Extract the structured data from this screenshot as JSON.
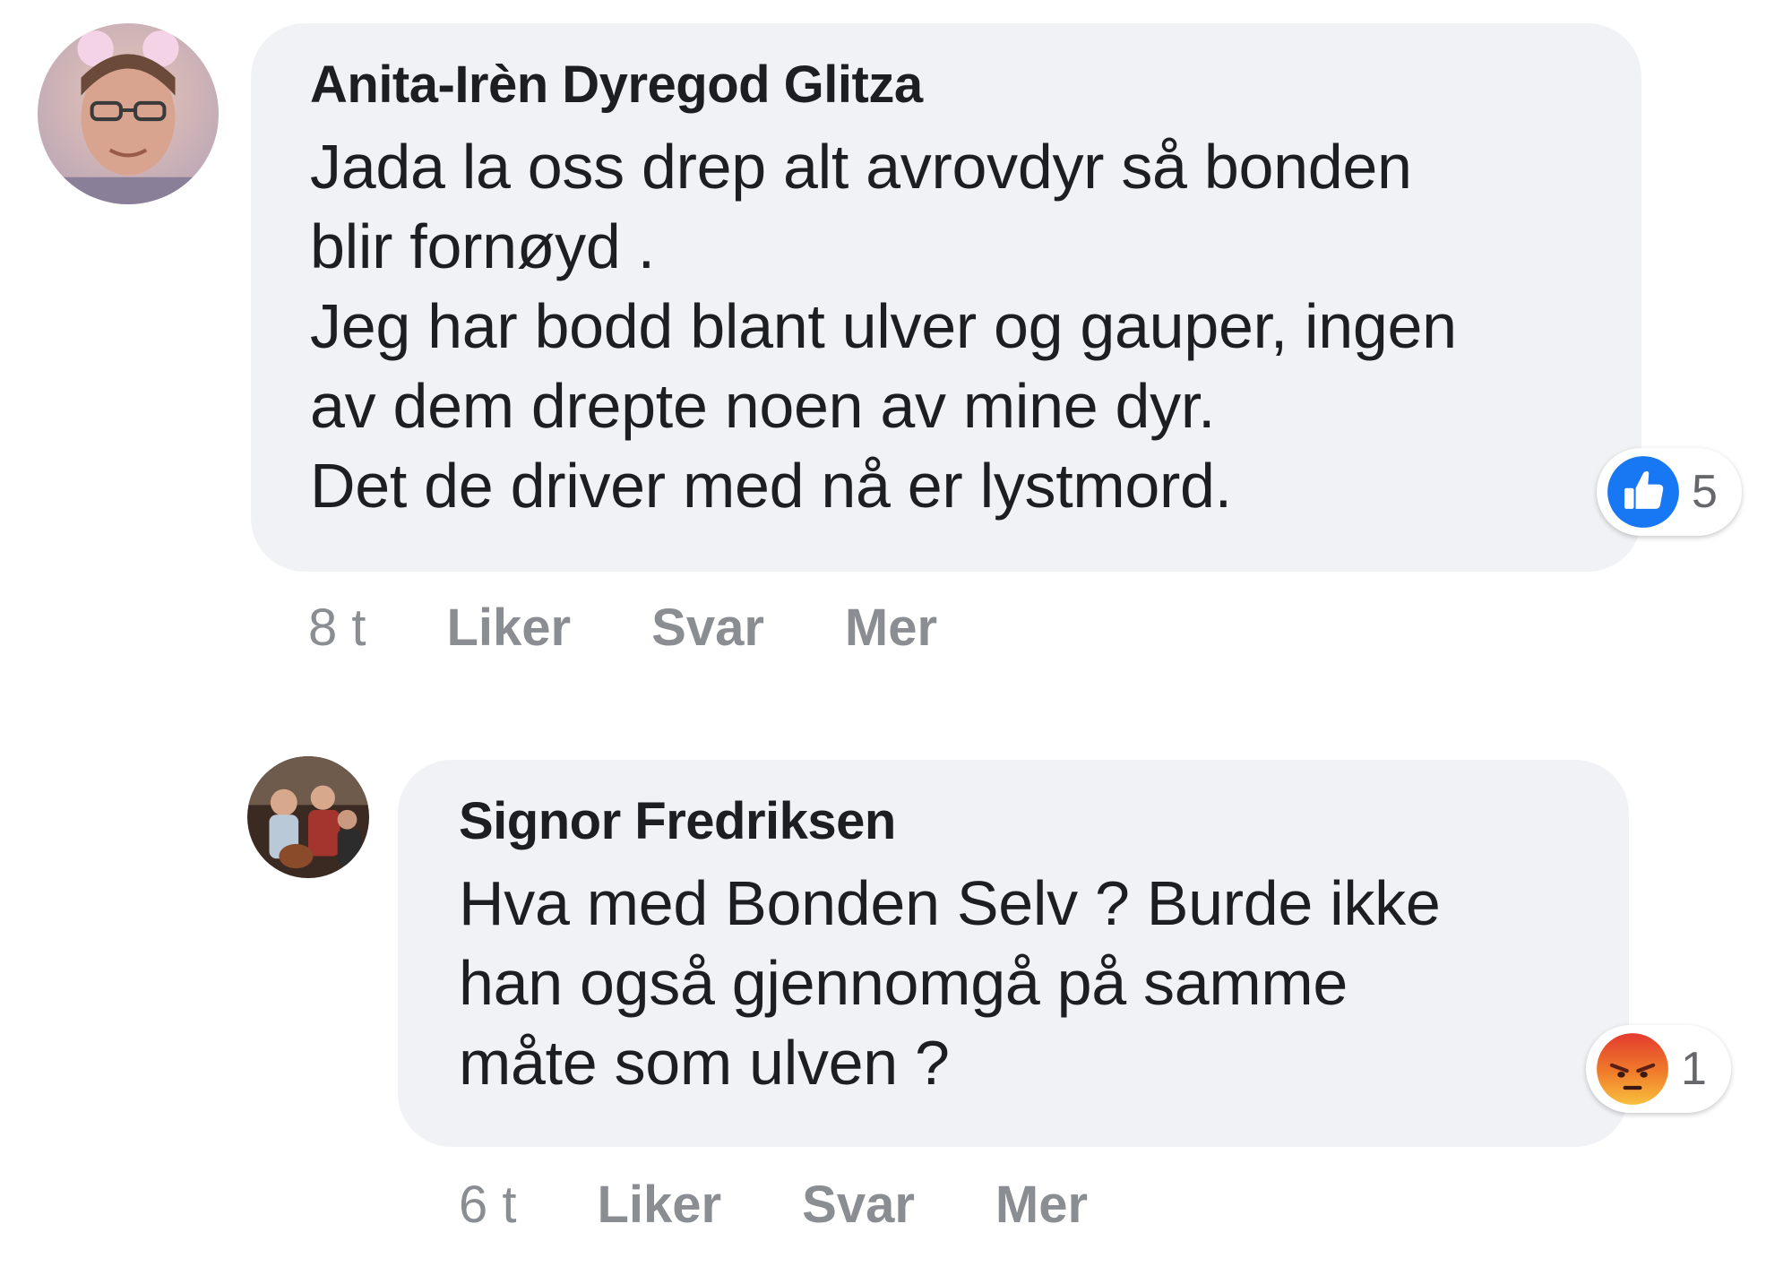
{
  "comments": [
    {
      "author": "Anita-Irèn Dyregod Glitza",
      "lines": [
        "Jada la oss drep alt avrovdyr så bonden",
        "blir fornøyd .",
        "Jeg har bodd blant ulver og gauper, ingen",
        "av dem drepte noen av mine dyr.",
        "Det de driver med nå er lystmord."
      ],
      "reaction": {
        "icon": "like-icon",
        "count": "5",
        "color": "#1877f2"
      },
      "time": "8 t",
      "actions": {
        "like": "Liker",
        "reply": "Svar",
        "more": "Mer"
      }
    },
    {
      "author": "Signor Fredriksen",
      "lines": [
        "Hva med Bonden Selv ? Burde ikke",
        "han også gjennomgå på samme",
        "måte som ulven ?"
      ],
      "reaction": {
        "icon": "angry-icon",
        "count": "1",
        "color": "#e9710f"
      },
      "time": "6 t",
      "actions": {
        "like": "Liker",
        "reply": "Svar",
        "more": "Mer"
      }
    }
  ],
  "colors": {
    "bubble": "#f0f2f5",
    "meta_text": "#8a8d91",
    "like_blue": "#1877f2"
  }
}
